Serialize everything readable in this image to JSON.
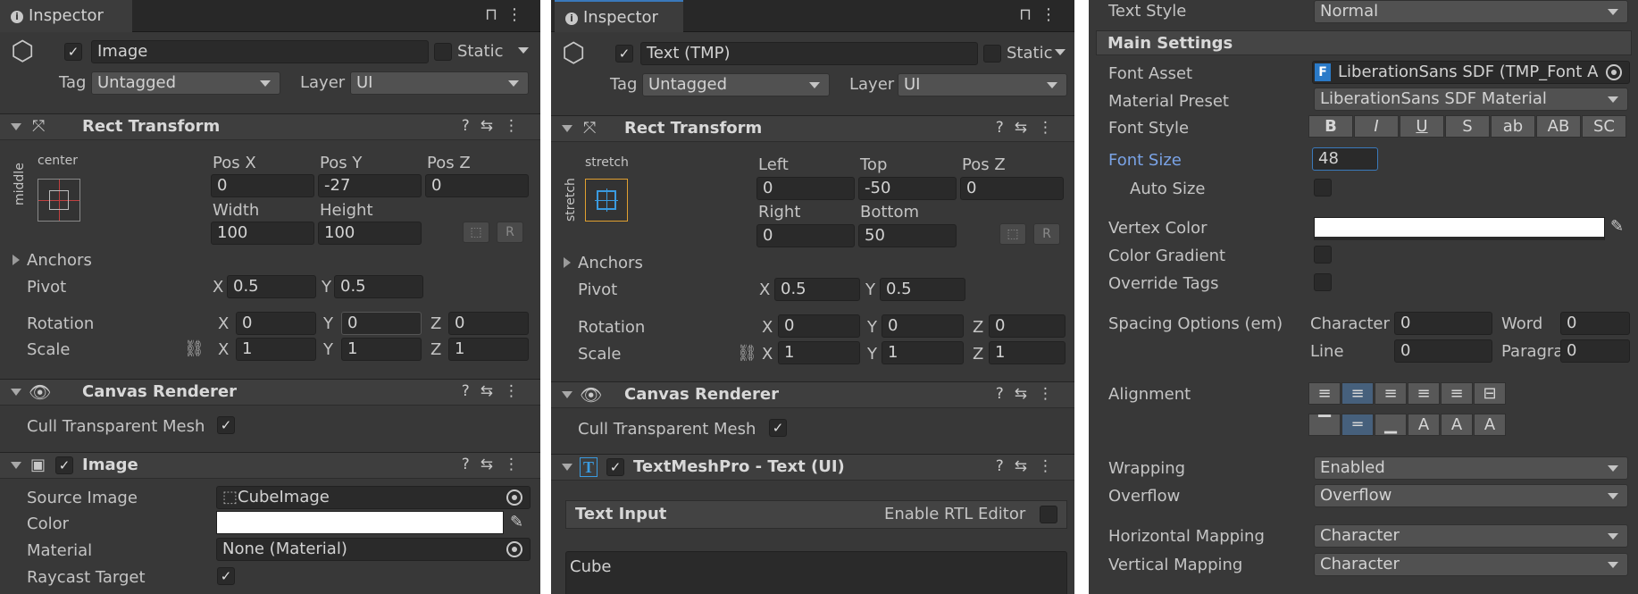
{
  "panel1": {
    "tab": "Inspector",
    "name": "Image",
    "static_label": "Static",
    "tag_label": "Tag",
    "tag_value": "Untagged",
    "layer_label": "Layer",
    "layer_value": "UI",
    "rect_title": "Rect Transform",
    "anchor_h": "center",
    "anchor_v": "middle",
    "col1": "Pos X",
    "col2": "Pos Y",
    "col3": "Pos Z",
    "v1": "0",
    "v2": "-27",
    "v3": "0",
    "col4": "Width",
    "col5": "Height",
    "v4": "100",
    "v5": "100",
    "anchors": "Anchors",
    "pivot": "Pivot",
    "pivot_x": "0.5",
    "pivot_y": "0.5",
    "rotation": "Rotation",
    "rot_x": "0",
    "rot_y": "0",
    "rot_z": "0",
    "scale": "Scale",
    "sc_x": "1",
    "sc_y": "1",
    "sc_z": "1",
    "canvas_title": "Canvas Renderer",
    "cull": "Cull Transparent Mesh",
    "image_title": "Image",
    "source_image_label": "Source Image",
    "source_image_value": "CubeImage",
    "color_label": "Color",
    "material_label": "Material",
    "material_value": "None (Material)",
    "raycast_label": "Raycast Target"
  },
  "panel2": {
    "tab": "Inspector",
    "name": "Text (TMP)",
    "static_label": "Static",
    "tag_label": "Tag",
    "tag_value": "Untagged",
    "layer_label": "Layer",
    "layer_value": "UI",
    "rect_title": "Rect Transform",
    "anchor_h": "stretch",
    "anchor_v": "stretch",
    "col1": "Left",
    "col2": "Top",
    "col3": "Pos Z",
    "v1": "0",
    "v2": "-50",
    "v3": "0",
    "col4": "Right",
    "col5": "Bottom",
    "v4": "0",
    "v5": "50",
    "anchors": "Anchors",
    "pivot": "Pivot",
    "pivot_x": "0.5",
    "pivot_y": "0.5",
    "rotation": "Rotation",
    "rot_x": "0",
    "rot_y": "0",
    "rot_z": "0",
    "scale": "Scale",
    "sc_x": "1",
    "sc_y": "1",
    "sc_z": "1",
    "canvas_title": "Canvas Renderer",
    "cull": "Cull Transparent Mesh",
    "tmp_title": "TextMeshPro - Text (UI)",
    "text_input": "Text Input",
    "rtl": "Enable RTL Editor",
    "text_value": "Cube"
  },
  "panel3": {
    "text_style_label": "Text Style",
    "text_style_value": "Normal",
    "main_settings": "Main Settings",
    "font_asset_label": "Font Asset",
    "font_asset_value": "LiberationSans SDF (TMP_Font A",
    "material_preset_label": "Material Preset",
    "material_preset_value": "LiberationSans SDF Material",
    "font_style_label": "Font Style",
    "font_style_buttons": [
      "B",
      "I",
      "U",
      "S",
      "ab",
      "AB",
      "SC"
    ],
    "font_size_label": "Font Size",
    "font_size_value": "48",
    "auto_size_label": "Auto Size",
    "vertex_color_label": "Vertex Color",
    "color_gradient_label": "Color Gradient",
    "override_tags_label": "Override Tags",
    "spacing_label": "Spacing Options (em)",
    "character_label": "Character",
    "character_value": "0",
    "word_label": "Word",
    "word_value": "0",
    "line_label": "Line",
    "line_value": "0",
    "paragraph_label": "Paragraph",
    "paragraph_value": "0",
    "alignment_label": "Alignment",
    "wrapping_label": "Wrapping",
    "wrapping_value": "Enabled",
    "overflow_label": "Overflow",
    "overflow_value": "Overflow",
    "hmap_label": "Horizontal Mapping",
    "hmap_value": "Character",
    "vmap_label": "Vertical Mapping",
    "vmap_value": "Character"
  },
  "colors": {
    "background": "#383838",
    "field": "#2a2a2a",
    "accent": "#3a79bb",
    "font_size_label": "#7aa3e6"
  }
}
